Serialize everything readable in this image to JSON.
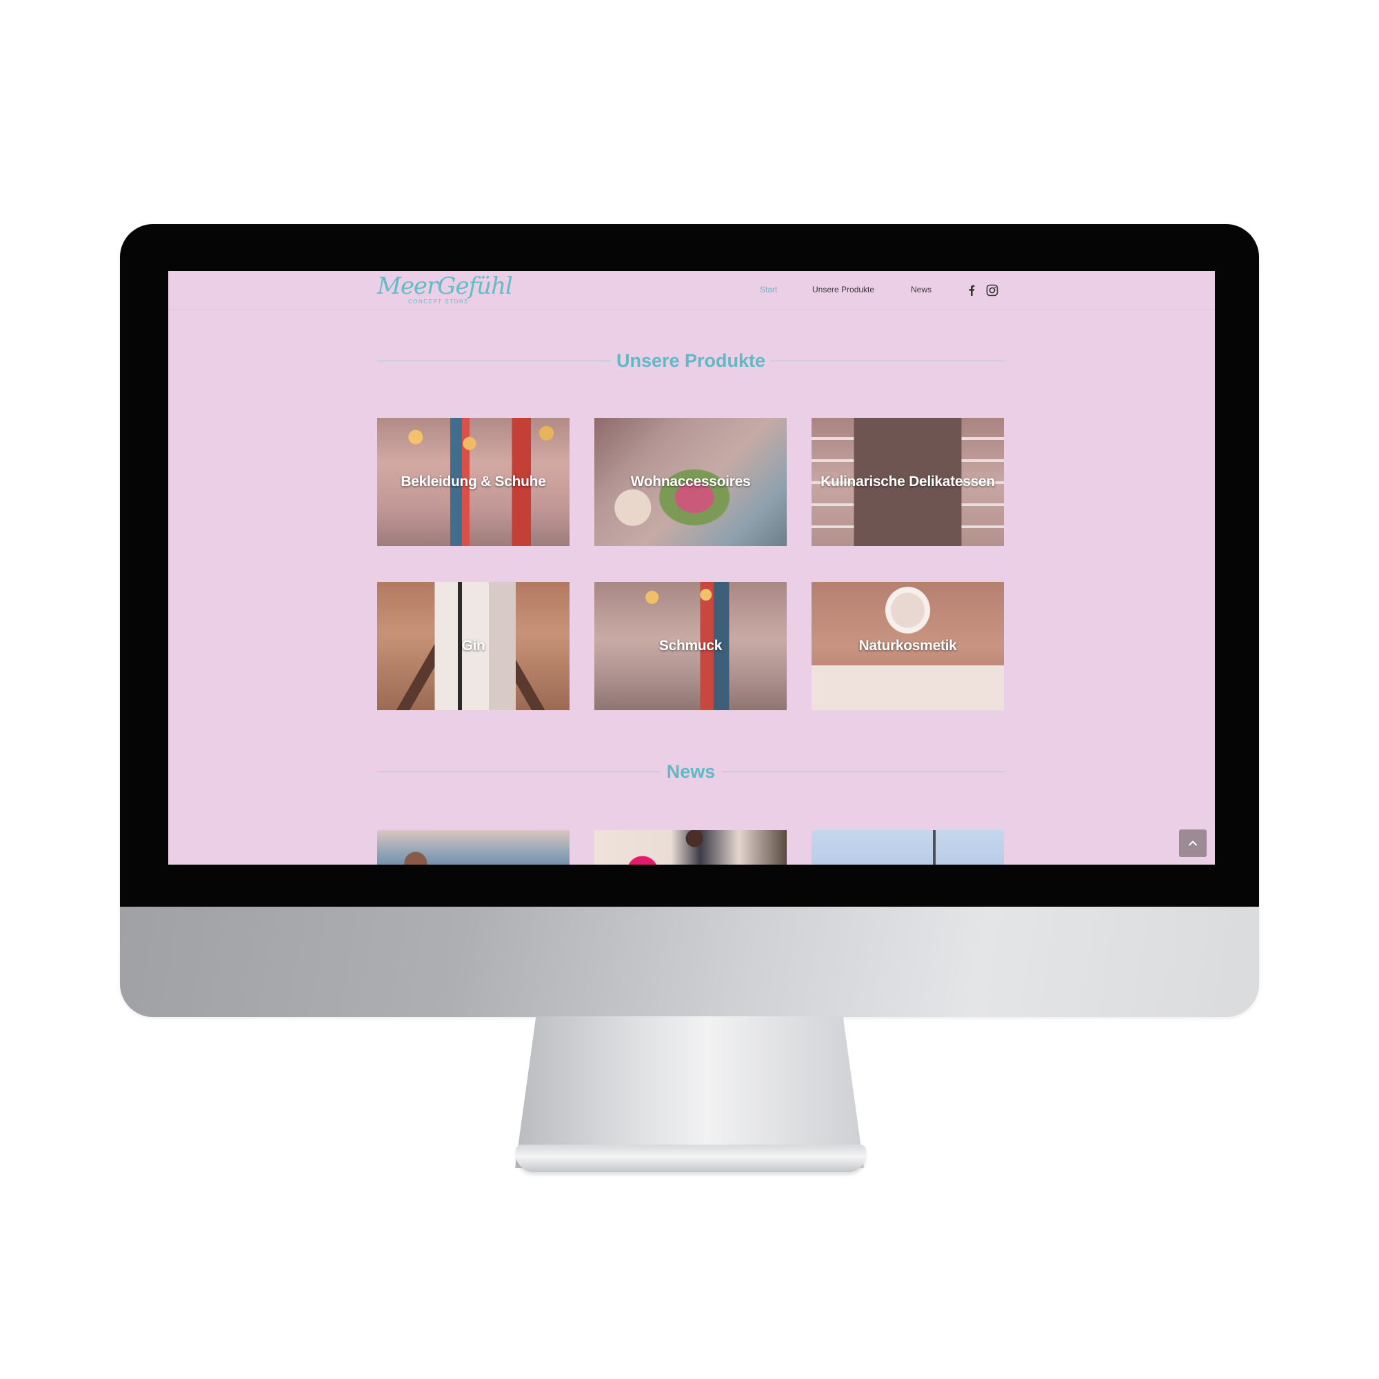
{
  "logo": {
    "script": "MeerGefühl",
    "sub": "CONCEPT STORE"
  },
  "nav": {
    "items": [
      {
        "label": "Start",
        "active": true
      },
      {
        "label": "Unsere Produkte",
        "active": false
      },
      {
        "label": "News",
        "active": false
      }
    ],
    "social": [
      "facebook-icon",
      "instagram-icon"
    ]
  },
  "sections": {
    "products_title": "Unsere Produkte",
    "news_title": "News"
  },
  "products": [
    {
      "label": "Bekleidung & Schuhe"
    },
    {
      "label": "Wohnaccessoires"
    },
    {
      "label": "Kulinarische Delikatessen"
    },
    {
      "label": "Gin"
    },
    {
      "label": "Schmuck"
    },
    {
      "label": "Naturkosmetik"
    }
  ],
  "colors": {
    "page_background": "#eacfe6",
    "accent": "#5fbac6",
    "scroll_button": "#9c8b95"
  },
  "icons": {
    "scroll_top": "chevron-up-icon"
  }
}
